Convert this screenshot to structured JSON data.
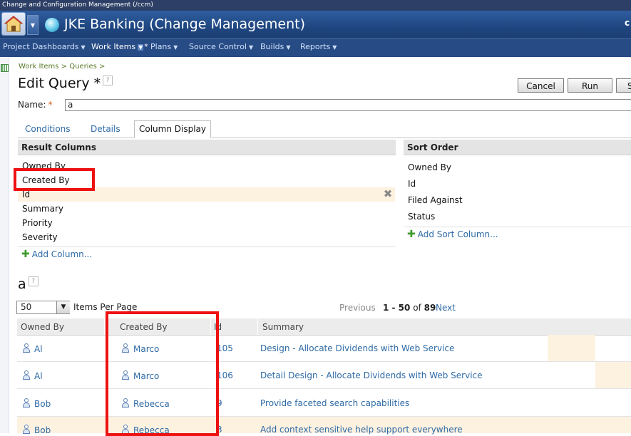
{
  "window_title": "Change and Configuration Management (/ccm)",
  "banner": {
    "project_title": "JKE Banking (Change Management)",
    "right_text": "c"
  },
  "nav": {
    "items": [
      {
        "label": "Project Dashboards"
      },
      {
        "label": "Work Items"
      },
      {
        "label": "Plans"
      },
      {
        "label": "Source Control"
      },
      {
        "label": "Builds"
      },
      {
        "label": "Reports"
      }
    ],
    "work_items_marker": "*"
  },
  "breadcrumb": "Work Items > Queries >",
  "page": {
    "title": "Edit Query *",
    "help": "?"
  },
  "toolbar": {
    "cancel": "Cancel",
    "run": "Run",
    "save": "S"
  },
  "name_field": {
    "label": "Name:",
    "required": "*",
    "value": "a"
  },
  "tabs": [
    {
      "label": "Conditions"
    },
    {
      "label": "Details"
    },
    {
      "label": "Column Display"
    }
  ],
  "result_columns": {
    "header": "Result Columns",
    "items": [
      "Owned By",
      "Created By",
      "Id",
      "Summary",
      "Priority",
      "Severity"
    ],
    "add_label": "Add Column..."
  },
  "sort_order": {
    "header": "Sort Order",
    "items": [
      "Owned By",
      "Id",
      "Filed Against",
      "Status"
    ],
    "add_label": "Add Sort Column..."
  },
  "results": {
    "title": "a",
    "per_page_value": "50",
    "per_page_label": "Items Per Page",
    "pager": {
      "previous": "Previous",
      "range": "1 - 50",
      "of": "of",
      "total": "89",
      "next": "Next"
    },
    "columns": [
      "Owned By",
      "Created By",
      "Id",
      "Summary"
    ],
    "rows": [
      {
        "owned_by": "Al",
        "created_by": "Marco",
        "id": "105",
        "summary": "Design - Allocate Dividends with Web Service"
      },
      {
        "owned_by": "Al",
        "created_by": "Marco",
        "id": "106",
        "summary": "Detail Design - Allocate Dividends with Web Service"
      },
      {
        "owned_by": "Bob",
        "created_by": "Rebecca",
        "id": "9",
        "summary": "Provide faceted search capabilities"
      },
      {
        "owned_by": "Bob",
        "created_by": "Rebecca",
        "id": "3",
        "summary": "Add context sensitive help support everywhere"
      }
    ]
  },
  "colors": {
    "banner": "#1f4680",
    "link": "#2e6aa5",
    "highlight": "#ee1111",
    "selected_row": "#fdf1e0"
  }
}
